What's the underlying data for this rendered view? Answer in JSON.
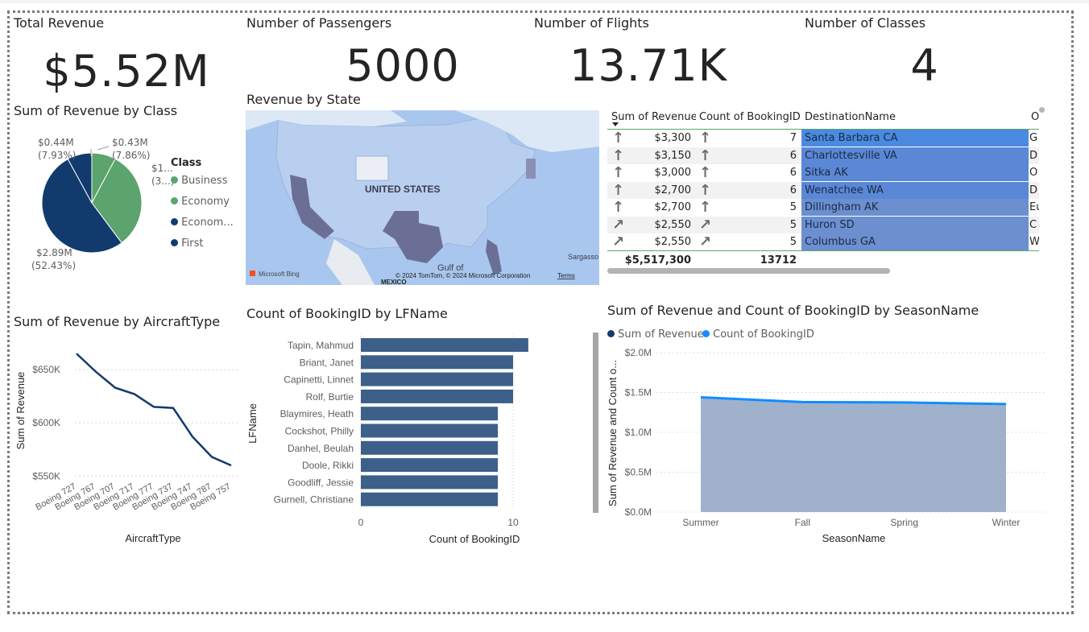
{
  "cards": [
    {
      "title": "Total Revenue",
      "value": "$5.52M"
    },
    {
      "title": "Number of Passengers",
      "value": "5000"
    },
    {
      "title": "Number of Flights",
      "value": "13.71K"
    },
    {
      "title": "Number of Classes",
      "value": "4"
    }
  ],
  "pie": {
    "title": "Sum of Revenue by Class",
    "legend_title": "Class",
    "slices": [
      {
        "name": "Business",
        "label": "$0.43M",
        "pct_label": "(7.86%)",
        "value": 0.43,
        "color": "#5ba46d"
      },
      {
        "name": "Economy",
        "label": "$1...",
        "pct_label": "(3...)",
        "value": 1.77,
        "color": "#5ba46d"
      },
      {
        "name": "Econom...",
        "label": "$2.89M",
        "pct_label": "(52.43%)",
        "value": 2.89,
        "color": "#123b6d"
      },
      {
        "name": "First",
        "label": "$0.44M",
        "pct_label": "(7.93%)",
        "value": 0.44,
        "color": "#123b6d"
      }
    ],
    "colors": {
      "green": "#5ba46d",
      "navy": "#123b6d"
    }
  },
  "map": {
    "title": "Revenue by State",
    "country_label": "UNITED STATES",
    "gulf_label": "Gulf of",
    "sargasso_label": "Sargasso",
    "copyright": "© 2024 TomTom, © 2024 Microsoft Corporation",
    "terms": "Terms",
    "bing": "Microsoft Bing",
    "mexico": "MEXICO"
  },
  "table": {
    "headers": [
      "Sum of Revenue",
      "Count of BookingID",
      "DestinationName",
      "O"
    ],
    "rows": [
      {
        "revenue": "$3,300",
        "count": "7",
        "dest": "Santa Barbara CA",
        "other": "G",
        "arrow": "up"
      },
      {
        "revenue": "$3,150",
        "count": "6",
        "dest": "Charlottesville VA",
        "other": "D",
        "arrow": "up"
      },
      {
        "revenue": "$3,000",
        "count": "6",
        "dest": "Sitka AK",
        "other": "O",
        "arrow": "up"
      },
      {
        "revenue": "$2,700",
        "count": "6",
        "dest": "Wenatchee WA",
        "other": "D",
        "arrow": "up"
      },
      {
        "revenue": "$2,700",
        "count": "5",
        "dest": "Dillingham AK",
        "other": "Eu",
        "arrow": "up"
      },
      {
        "revenue": "$2,550",
        "count": "5",
        "dest": "Huron SD",
        "other": "C",
        "arrow": "diag"
      },
      {
        "revenue": "$2,550",
        "count": "5",
        "dest": "Columbus GA",
        "other": "W",
        "arrow": "diag"
      }
    ],
    "totals": {
      "revenue": "$5,517,300",
      "count": "13712"
    }
  },
  "chart_data": [
    {
      "type": "line",
      "title": "Sum of Revenue by AircraftType",
      "xlabel": "AircraftType",
      "ylabel": "Sum of Revenue",
      "categories": [
        "Boeing 727",
        "Boeing 767",
        "Boeing 707",
        "Boeing 717",
        "Boeing 777",
        "Boeing 737",
        "Boeing 747",
        "Boeing 787",
        "Boeing 757"
      ],
      "values": [
        665000,
        648000,
        633000,
        627000,
        615000,
        614000,
        587000,
        568000,
        560000
      ],
      "yticks": [
        "$650K",
        "$600K",
        "$550K"
      ],
      "ytick_values": [
        650000,
        600000,
        550000
      ],
      "ylim": [
        545000,
        672000
      ],
      "color": "#123b6d"
    },
    {
      "type": "bar",
      "title": "Count of BookingID by LFName",
      "xlabel": "Count of BookingID",
      "ylabel": "LFName",
      "categories": [
        "Tapin, Mahmud",
        "Briant, Janet",
        "Capinetti, Linnet",
        "Rolf, Burtie",
        "Blaymires, Heath",
        "Cockshot, Philly",
        "Danhel, Beulah",
        "Doole, Rikki",
        "Goodliff, Jessie",
        "Gurnell, Christiane"
      ],
      "values": [
        11,
        10,
        10,
        10,
        9,
        9,
        9,
        9,
        9,
        9
      ],
      "xticks": [
        "0",
        "10"
      ],
      "xtick_values": [
        0,
        10
      ],
      "xlim": [
        0,
        11.3
      ],
      "color": "#3d5f8a"
    },
    {
      "type": "area",
      "title": "Sum of Revenue and Count of BookingID by SeasonName",
      "xlabel": "SeasonName",
      "ylabel": "Sum of Revenue and Count o...",
      "categories": [
        "Summer",
        "Fall",
        "Spring",
        "Winter"
      ],
      "series": [
        {
          "name": "Sum of Revenue",
          "values": [
            1430000,
            1370000,
            1370000,
            1350000
          ],
          "color": "#123b6d"
        },
        {
          "name": "Count of BookingID",
          "values": [
            1440000,
            1380000,
            1375000,
            1355000
          ],
          "color": "#118dff"
        }
      ],
      "yticks": [
        "$2.0M",
        "$1.5M",
        "$1.0M",
        "$0.5M",
        "$0.0M"
      ],
      "ytick_values": [
        2000000,
        1500000,
        1000000,
        500000,
        0
      ],
      "ylim": [
        0,
        2000000
      ],
      "area_color": "#a0b2cb"
    }
  ]
}
